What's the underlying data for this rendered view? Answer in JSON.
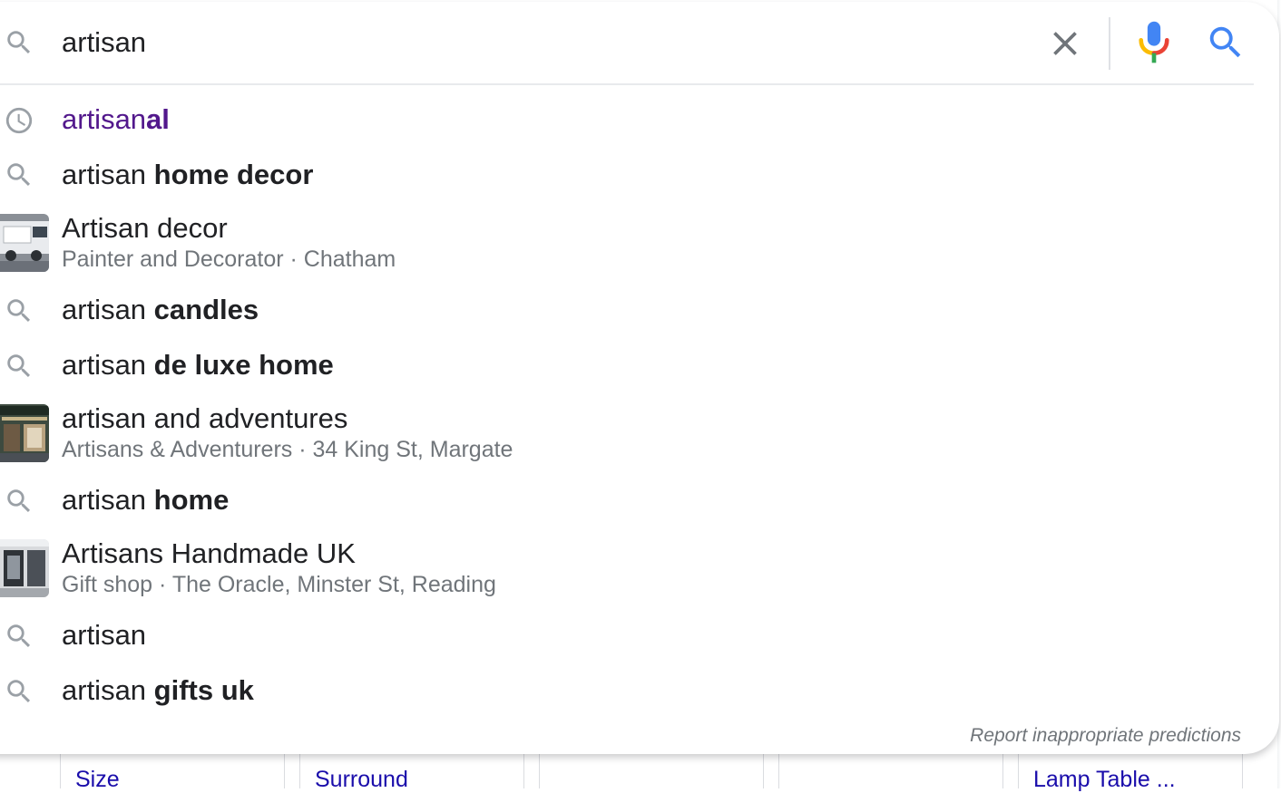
{
  "search": {
    "query": "artisan",
    "clear_label": "clear-icon",
    "mic_label": "microphone-icon",
    "search_label": "search-icon"
  },
  "suggestions": [
    {
      "type": "history",
      "prefix": "artisan",
      "suffix": "al",
      "icon": "history-icon"
    },
    {
      "type": "query",
      "prefix": "artisan ",
      "suffix": "home decor",
      "icon": "search-icon"
    },
    {
      "type": "place",
      "title": "Artisan decor",
      "subtitle": "Painter and Decorator · Chatham",
      "icon": "place-thumbnail"
    },
    {
      "type": "query",
      "prefix": "artisan ",
      "suffix": "candles",
      "icon": "search-icon"
    },
    {
      "type": "query",
      "prefix": "artisan ",
      "suffix": "de luxe home",
      "icon": "search-icon"
    },
    {
      "type": "place",
      "title": "artisan and adventures",
      "subtitle": "Artisans & Adventurers · 34 King St, Margate",
      "icon": "place-thumbnail"
    },
    {
      "type": "query",
      "prefix": "artisan ",
      "suffix": "home",
      "icon": "search-icon"
    },
    {
      "type": "place",
      "title": "Artisans Handmade UK",
      "subtitle": "Gift shop · The Oracle, Minster St, Reading",
      "icon": "place-thumbnail"
    },
    {
      "type": "query",
      "prefix": "artisan",
      "suffix": "",
      "icon": "search-icon"
    },
    {
      "type": "query",
      "prefix": "artisan ",
      "suffix": "gifts uk",
      "icon": "search-icon"
    }
  ],
  "report_link": "Report inappropriate predictions",
  "background_cards": [
    {
      "label": "Size"
    },
    {
      "label": "Surround"
    },
    {
      "label": ""
    },
    {
      "label": ""
    },
    {
      "label": "Lamp Table ..."
    }
  ],
  "colors": {
    "text": "#202124",
    "secondary": "#70757a",
    "visited": "#52188c",
    "link": "#1a0dab",
    "google_blue": "#4285f4",
    "google_red": "#ea4335",
    "google_yellow": "#fbbc05",
    "google_green": "#34a853"
  }
}
